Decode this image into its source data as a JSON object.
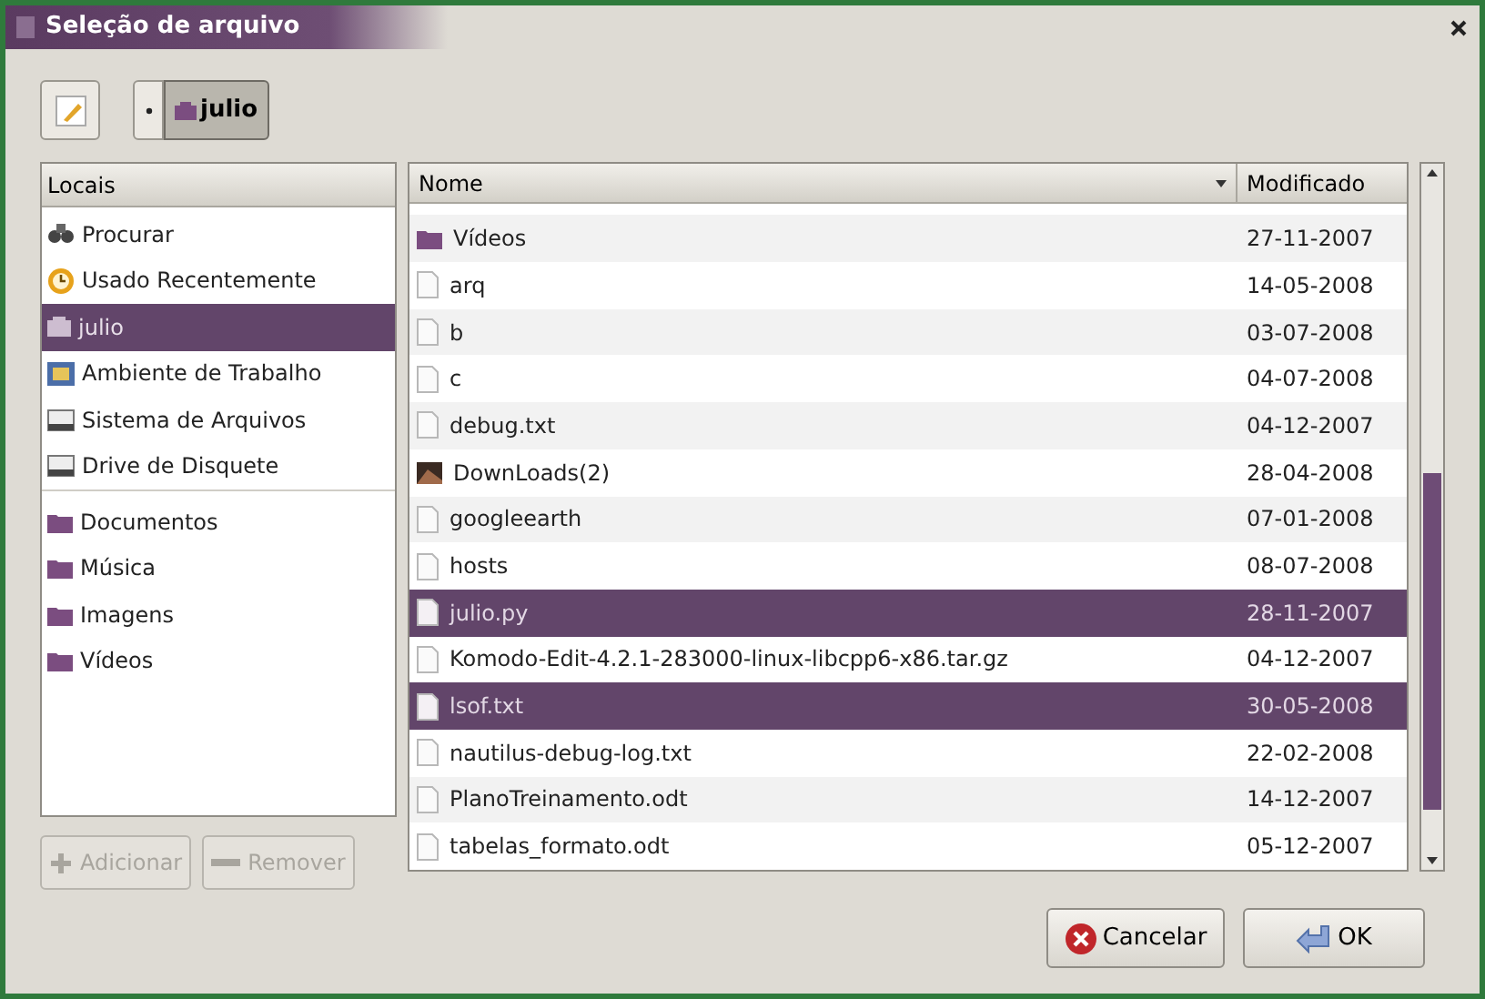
{
  "window": {
    "title": "Seleção de arquivo"
  },
  "path_bar": {
    "segments": [
      {
        "label": "julio",
        "selected": true
      }
    ]
  },
  "places": {
    "header": "Locais",
    "groups": [
      [
        {
          "label": "Procurar",
          "kind": "search",
          "selected": false
        },
        {
          "label": "Usado Recentemente",
          "kind": "recent",
          "selected": false
        },
        {
          "label": "julio",
          "kind": "home",
          "selected": true
        },
        {
          "label": "Ambiente de Trabalho",
          "kind": "desktop",
          "selected": false
        },
        {
          "label": "Sistema de Arquivos",
          "kind": "drive",
          "selected": false
        },
        {
          "label": "Drive de Disquete",
          "kind": "drive",
          "selected": false
        }
      ],
      [
        {
          "label": "Documentos",
          "kind": "folder",
          "selected": false
        },
        {
          "label": "Música",
          "kind": "folder",
          "selected": false
        },
        {
          "label": "Imagens",
          "kind": "folder",
          "selected": false
        },
        {
          "label": "Vídeos",
          "kind": "folder",
          "selected": false
        }
      ]
    ],
    "buttons": [
      {
        "label": "Adicionar",
        "disabled": true
      },
      {
        "label": "Remover",
        "disabled": true
      }
    ]
  },
  "files": {
    "columns": [
      "Nome",
      "Modificado"
    ],
    "rows": [
      {
        "name": "Vídeos",
        "modified": "27-11-2007",
        "kind": "folder",
        "selected": false
      },
      {
        "name": "arq",
        "modified": "14-05-2008",
        "kind": "file",
        "selected": false
      },
      {
        "name": "b",
        "modified": "03-07-2008",
        "kind": "file",
        "selected": false
      },
      {
        "name": "c",
        "modified": "04-07-2008",
        "kind": "file",
        "selected": false
      },
      {
        "name": "debug.txt",
        "modified": "04-12-2007",
        "kind": "file",
        "selected": false
      },
      {
        "name": "DownLoads(2)",
        "modified": "28-04-2008",
        "kind": "image",
        "selected": false
      },
      {
        "name": "googleearth",
        "modified": "07-01-2008",
        "kind": "file",
        "selected": false
      },
      {
        "name": "hosts",
        "modified": "08-07-2008",
        "kind": "file",
        "selected": false
      },
      {
        "name": "julio.py",
        "modified": "28-11-2007",
        "kind": "file",
        "selected": true
      },
      {
        "name": "Komodo-Edit-4.2.1-283000-linux-libcpp6-x86.tar.gz",
        "modified": "04-12-2007",
        "kind": "file",
        "selected": false
      },
      {
        "name": "lsof.txt",
        "modified": "30-05-2008",
        "kind": "file",
        "selected": true
      },
      {
        "name": "nautilus-debug-log.txt",
        "modified": "22-02-2008",
        "kind": "file",
        "selected": false
      },
      {
        "name": "PlanoTreinamento.odt",
        "modified": "14-12-2007",
        "kind": "file",
        "selected": false
      },
      {
        "name": "tabelas_formato.odt",
        "modified": "05-12-2007",
        "kind": "file",
        "selected": false
      }
    ]
  },
  "actions": [
    {
      "label": "Cancelar",
      "kind": "cancel"
    },
    {
      "label": "OK",
      "kind": "ok"
    }
  ]
}
